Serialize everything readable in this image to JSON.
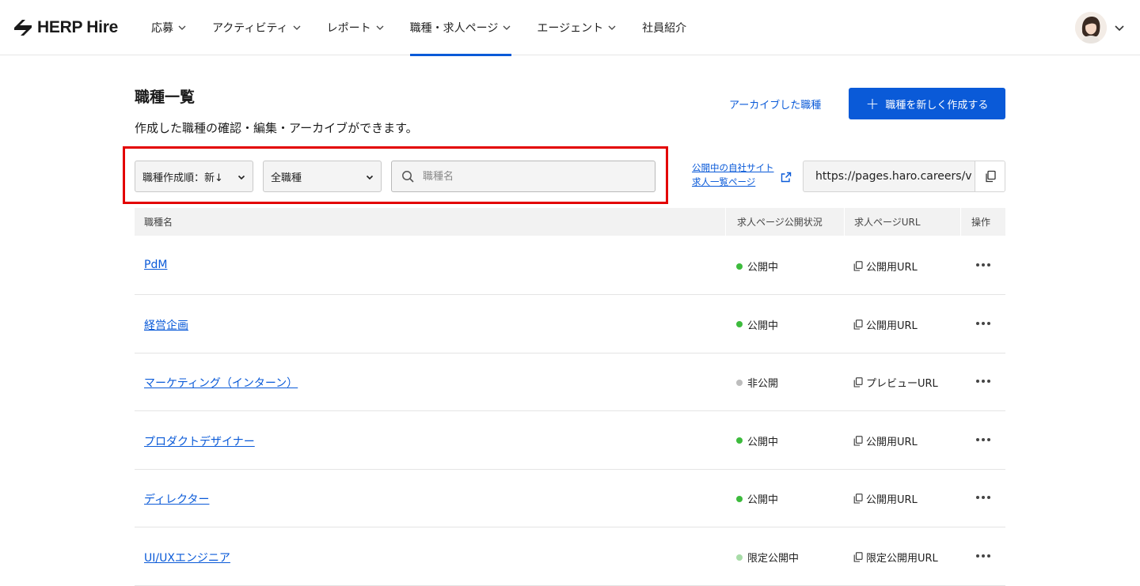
{
  "app": {
    "logo_text": "HERP Hire"
  },
  "nav": [
    {
      "label": "応募",
      "has_chevron": true,
      "active": false
    },
    {
      "label": "アクティビティ",
      "has_chevron": true,
      "active": false
    },
    {
      "label": "レポート",
      "has_chevron": true,
      "active": false
    },
    {
      "label": "職種・求人ページ",
      "has_chevron": true,
      "active": true
    },
    {
      "label": "エージェント",
      "has_chevron": true,
      "active": false
    },
    {
      "label": "社員紹介",
      "has_chevron": false,
      "active": false
    }
  ],
  "page": {
    "title": "職種一覧",
    "description": "作成した職種の確認・編集・アーカイブができます。",
    "archive_link": "アーカイブした職種",
    "create_button": "職種を新しく作成する"
  },
  "filters": {
    "sort_value": "職種作成順：新↓",
    "kind_value": "全職種",
    "search_placeholder": "職種名",
    "site_link_line1": "公開中の自社サイト",
    "site_link_line2": "求人一覧ページ",
    "site_url": "https://pages.haro.careers/v"
  },
  "table": {
    "headers": [
      "職種名",
      "求人ページ公開状況",
      "求人ページURL",
      "操作"
    ],
    "rows": [
      {
        "name": "PdM",
        "status": "公開中",
        "status_color": "#3dbb3d",
        "url_label": "公開用URL"
      },
      {
        "name": "経営企画",
        "status": "公開中",
        "status_color": "#3dbb3d",
        "url_label": "公開用URL"
      },
      {
        "name": "マーケティング（インターン）",
        "status": "非公開",
        "status_color": "#bdbdbd",
        "url_label": "プレビューURL"
      },
      {
        "name": "プロダクトデザイナー",
        "status": "公開中",
        "status_color": "#3dbb3d",
        "url_label": "公開用URL"
      },
      {
        "name": "ディレクター",
        "status": "公開中",
        "status_color": "#3dbb3d",
        "url_label": "公開用URL"
      },
      {
        "name": "UI/UXエンジニア",
        "status": "限定公開中",
        "status_color": "#a8dca8",
        "url_label": "限定公開用URL"
      }
    ]
  },
  "colors": {
    "accent": "#0a5ad8",
    "highlight": "#e30000"
  }
}
